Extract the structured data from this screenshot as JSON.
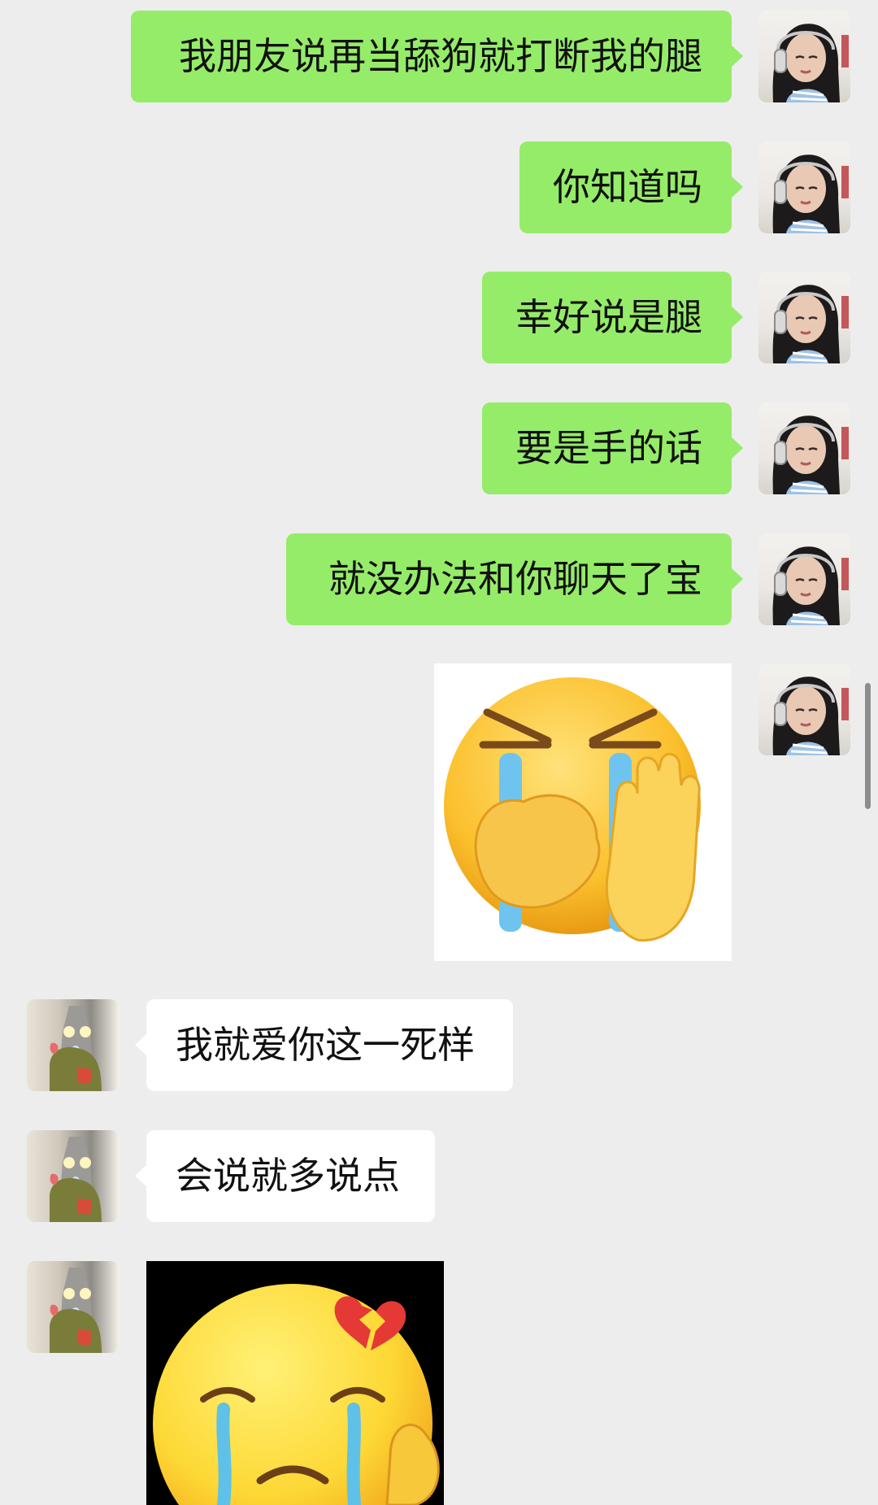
{
  "messages": [
    {
      "side": "out",
      "text": "我朋友说再当舔狗就打断我的腿"
    },
    {
      "side": "out",
      "text": "你知道吗"
    },
    {
      "side": "out",
      "text": "幸好说是腿"
    },
    {
      "side": "out",
      "text": "要是手的话"
    },
    {
      "side": "out",
      "text": "就没办法和你聊天了宝"
    },
    {
      "side": "out",
      "sticker": "crying-face-covering-mouth-raised-hand-emoji"
    },
    {
      "side": "in",
      "text": "我就爱你这一死样"
    },
    {
      "side": "in",
      "text": "会说就多说点"
    },
    {
      "side": "in",
      "sticker": "crying-face-broken-heart-emoji"
    }
  ],
  "colors": {
    "background": "#ededed",
    "outgoing_bubble": "#95ec69",
    "incoming_bubble": "#ffffff"
  },
  "icons": {
    "self_avatar": "girl-with-headphones-avatar",
    "peer_avatar": "ultraman-avatar"
  }
}
